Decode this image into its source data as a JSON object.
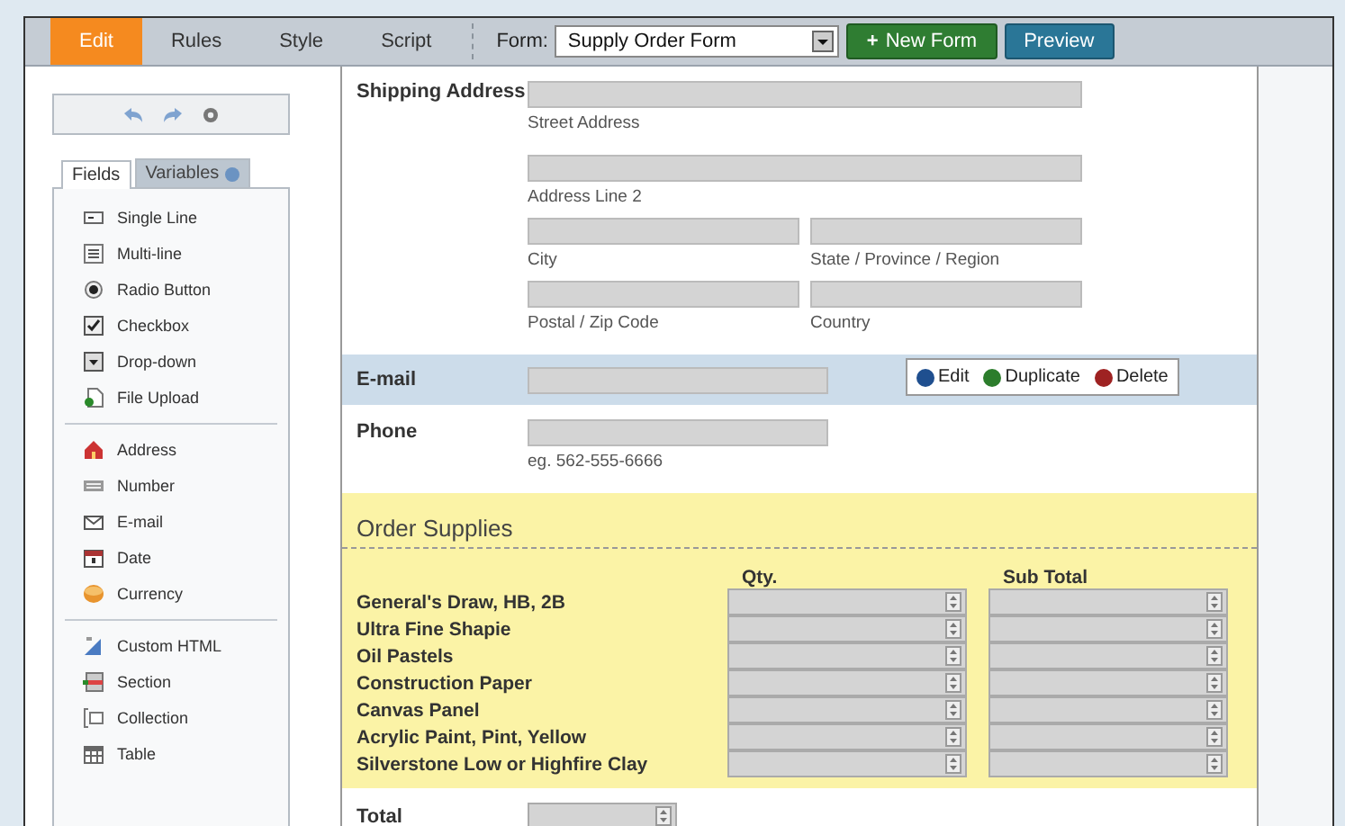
{
  "toolbar": {
    "tabs": [
      {
        "label": "Edit",
        "selected": true
      },
      {
        "label": "Rules",
        "selected": false
      },
      {
        "label": "Style",
        "selected": false
      },
      {
        "label": "Script",
        "selected": false
      }
    ],
    "form_label": "Form:",
    "form_select": "Supply Order Form",
    "buttons": [
      {
        "label": "New Form",
        "kind": "new",
        "glyph": "+"
      },
      {
        "label": "Preview",
        "kind": "preview"
      }
    ]
  },
  "sidebar": {
    "tabs": [
      {
        "label": "Fields",
        "selected": true,
        "help": false
      },
      {
        "label": "Variables",
        "selected": false,
        "help": true
      }
    ],
    "groups": [
      [
        {
          "label": "Single Line",
          "kind": "single"
        },
        {
          "label": "Multi-line",
          "kind": "multi"
        },
        {
          "label": "Radio Button",
          "kind": "radio"
        },
        {
          "label": "Checkbox",
          "kind": "checkbox"
        },
        {
          "label": "Drop-down",
          "kind": "dropdown"
        },
        {
          "label": "File Upload",
          "kind": "upload"
        }
      ],
      [
        {
          "label": "Address",
          "kind": "address"
        },
        {
          "label": "Number",
          "kind": "number"
        },
        {
          "label": "E-mail",
          "kind": "email"
        },
        {
          "label": "Date",
          "kind": "date"
        },
        {
          "label": "Currency",
          "kind": "currency"
        }
      ],
      [
        {
          "label": "Custom HTML",
          "kind": "html"
        },
        {
          "label": "Section",
          "kind": "section"
        },
        {
          "label": "Collection",
          "kind": "collection"
        },
        {
          "label": "Table",
          "kind": "table"
        }
      ]
    ]
  },
  "form": {
    "fields": [
      {
        "kind": "address",
        "label": "Shipping Address",
        "selected": false,
        "sublabels": [
          "Street Address",
          "Address Line 2",
          "City",
          "State / Province / Region",
          "Postal / Zip Code",
          "Country"
        ]
      },
      {
        "kind": "text",
        "label": "E-mail",
        "selected": true
      },
      {
        "kind": "text",
        "label": "Phone",
        "selected": false,
        "hint": "eg. 562-555-6666"
      }
    ],
    "actions": [
      {
        "label": "Edit",
        "kind": "info"
      },
      {
        "label": "Duplicate",
        "kind": "add"
      },
      {
        "label": "Delete",
        "kind": "remove"
      }
    ],
    "section": {
      "title": "Order Supplies",
      "columns": [
        "Qty.",
        "Sub Total"
      ],
      "rows": [
        "General's Draw, HB, 2B",
        "Ultra Fine Shapie",
        "Oil Pastels",
        "Construction Paper",
        "Canvas Panel",
        "Acrylic Paint, Pint, Yellow",
        "Silverstone Low or Highfire Clay"
      ]
    },
    "total": {
      "label": "Total"
    }
  }
}
